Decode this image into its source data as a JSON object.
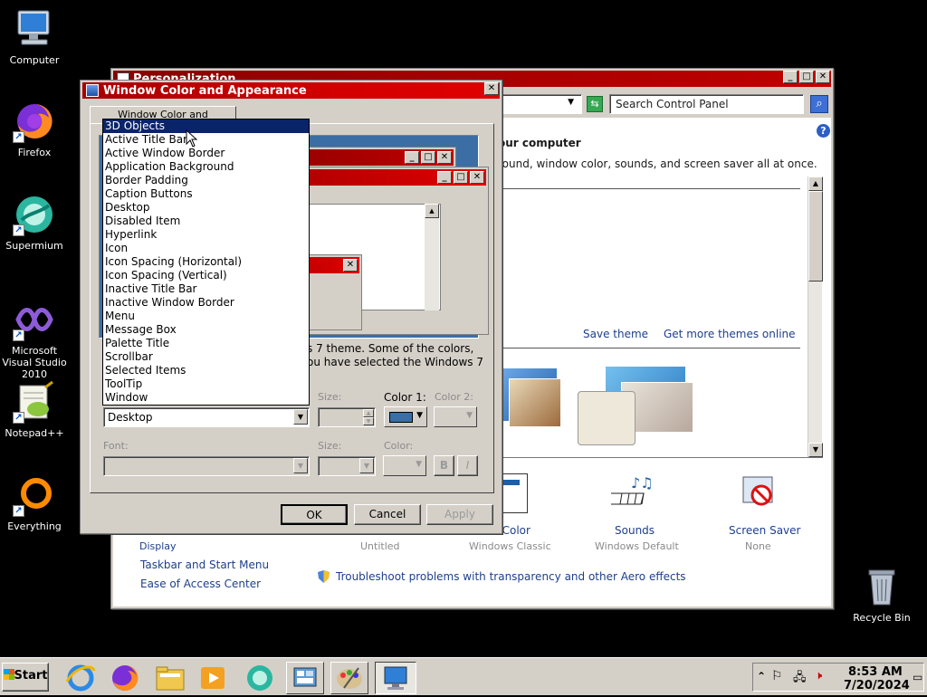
{
  "desktop": {
    "icons": [
      {
        "label": "Computer",
        "icon": "computer-icon"
      },
      {
        "label": "Firefox",
        "icon": "firefox-icon"
      },
      {
        "label": "Supermium",
        "icon": "supermium-icon"
      },
      {
        "label": "Microsoft Visual Studio 2010",
        "icon": "visual-studio-icon"
      },
      {
        "label": "Notepad++",
        "icon": "notepadpp-icon"
      },
      {
        "label": "Everything",
        "icon": "everything-icon"
      },
      {
        "label": "Recycle Bin",
        "icon": "recycle-bin-icon"
      }
    ]
  },
  "personalization": {
    "title": "Personalization",
    "search_placeholder": "Search Control Panel",
    "heading": "our computer",
    "subheading": "round, window color, sounds, and screen saver all at once.",
    "save_theme": "Save theme",
    "get_more_themes": "Get more themes online",
    "bottom_items": [
      {
        "label": "w Color",
        "sub": "Windows Classic"
      },
      {
        "label": "Sounds",
        "sub": "Windows Default"
      },
      {
        "label": "Screen Saver",
        "sub": "None"
      }
    ],
    "untitled": "Untitled",
    "left_links": [
      "Display",
      "Taskbar and Start Menu",
      "Ease of Access Center"
    ],
    "troubleshoot": "Troubleshoot problems with transparency and other Aero effects"
  },
  "dialog": {
    "title": "Window Color and Appearance",
    "tab": "Window Color and Appearance",
    "info_line1": "s 7 theme.  Some of the colors,",
    "info_line2": "ou have selected the Windows 7",
    "item_value": "Desktop",
    "size_label": "Size:",
    "color1_label": "Color 1:",
    "color2_label": "Color 2:",
    "font_label": "Font:",
    "font_size_label": "Size:",
    "font_color_label": "Color:",
    "bold_label": "B",
    "italic_label": "I",
    "ok": "OK",
    "cancel": "Cancel",
    "apply": "Apply",
    "color1_value": "#3a6ea5",
    "dropdown_items": [
      "3D Objects",
      "Active Title Bar",
      "Active Window Border",
      "Application Background",
      "Border Padding",
      "Caption Buttons",
      "Desktop",
      "Disabled Item",
      "Hyperlink",
      "Icon",
      "Icon Spacing (Horizontal)",
      "Icon Spacing (Vertical)",
      "Inactive Title Bar",
      "Inactive Window Border",
      "Menu",
      "Message Box",
      "Palette Title",
      "Scrollbar",
      "Selected Items",
      "ToolTip",
      "Window"
    ],
    "selected_index": 0
  },
  "taskbar": {
    "start_label": "Start",
    "time": "8:53 AM",
    "date": "7/20/2024"
  }
}
